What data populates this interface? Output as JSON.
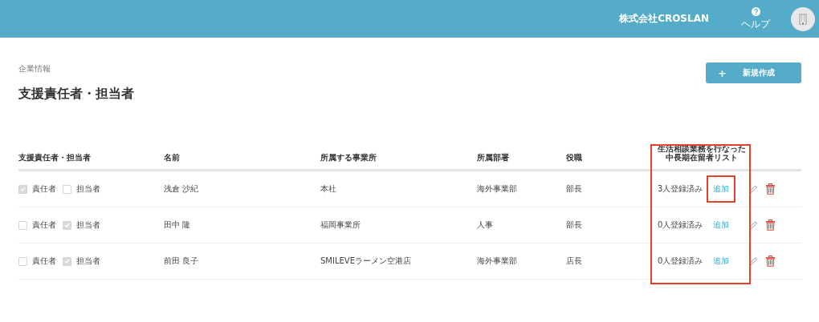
{
  "header": {
    "company": "株式会社CROSLAN",
    "help_label": "ヘルプ"
  },
  "breadcrumb": "企業情報",
  "title": "支援責任者・担当者",
  "create_button": {
    "icon": "+",
    "label": "新規作成"
  },
  "table": {
    "columns": [
      {
        "label": "支援責任者・担当者"
      },
      {
        "label": "名前"
      },
      {
        "label": "所属する事業所"
      },
      {
        "label": "所属部署"
      },
      {
        "label": "役職"
      },
      {
        "label_lines": [
          "生活相談業務を行なった",
          "中長期在留者リスト"
        ],
        "highlighted": true
      }
    ],
    "rows": [
      {
        "roles": [
          {
            "label": "責任者",
            "checked": true
          },
          {
            "label": "担当者",
            "checked": false
          }
        ],
        "name": "浅倉 沙紀",
        "office": "本社",
        "department": "海外事業部",
        "position": "部長",
        "registered": "3人登録済み",
        "add_link": "追加",
        "add_highlighted": true
      },
      {
        "roles": [
          {
            "label": "責任者",
            "checked": false
          },
          {
            "label": "担当者",
            "checked": true
          }
        ],
        "name": "田中 隆",
        "office": "福岡事業所",
        "department": "人事",
        "position": "部長",
        "registered": "0人登録済み",
        "add_link": "追加",
        "add_highlighted": false
      },
      {
        "roles": [
          {
            "label": "責任者",
            "checked": false
          },
          {
            "label": "担当者",
            "checked": true
          }
        ],
        "name": "前田 良子",
        "office": "SMILEVEラーメン空港店",
        "department": "海外事業部",
        "position": "店長",
        "registered": "0人登録済み",
        "add_link": "追加",
        "add_highlighted": false
      }
    ]
  }
}
